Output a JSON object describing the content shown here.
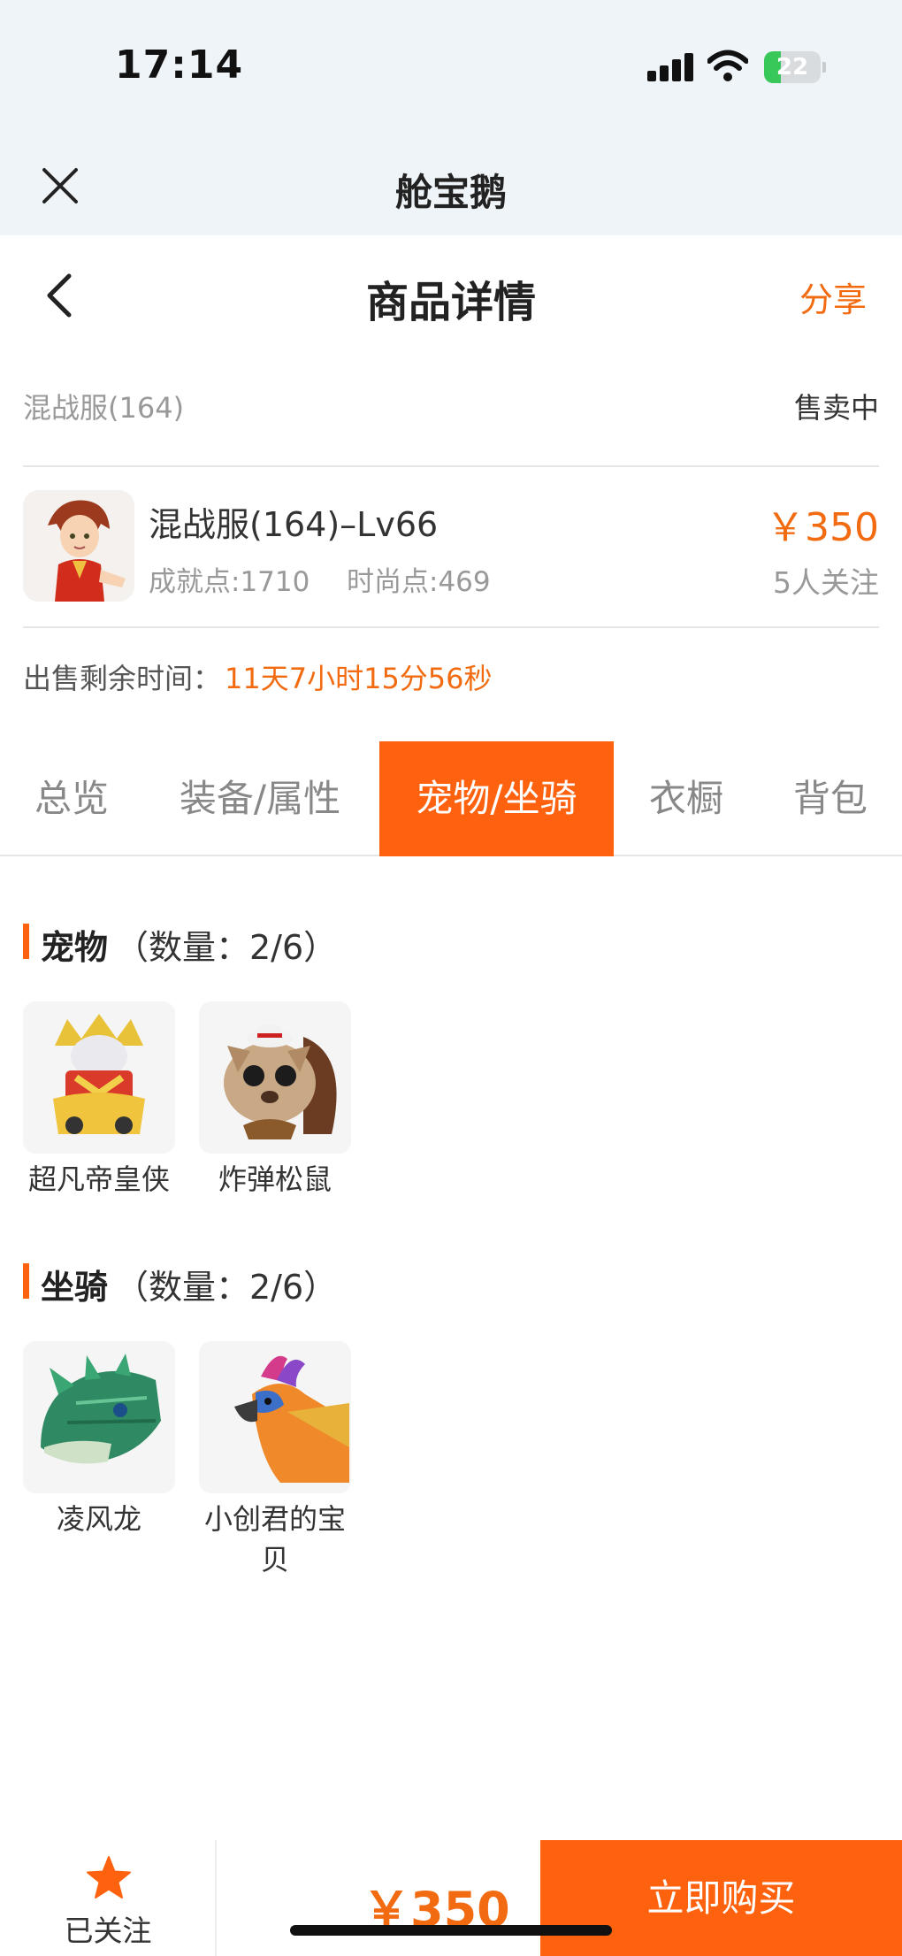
{
  "status_bar": {
    "time": "17:14",
    "battery": "22",
    "battery_level": 0.22
  },
  "mini_program": {
    "title": "舱宝鹅"
  },
  "header": {
    "title": "商品详情",
    "share": "分享"
  },
  "server": {
    "name": "混战服(164)",
    "status": "售卖中"
  },
  "product": {
    "title": "混战服(164)–Lv66",
    "achievement": "成就点:1710",
    "fashion": "时尚点:469",
    "price": "￥350",
    "followers": "5人关注"
  },
  "remaining": {
    "label": "出售剩余时间：",
    "value": "11天7小时15分56秒"
  },
  "tabs": [
    {
      "label": "总览",
      "active": false
    },
    {
      "label": "装备/属性",
      "active": false
    },
    {
      "label": "宠物/坐骑",
      "active": true
    },
    {
      "label": "衣橱",
      "active": false
    },
    {
      "label": "背包",
      "active": false
    }
  ],
  "pets": {
    "title": "宠物",
    "count": "（数量：2/6）",
    "items": [
      {
        "name": "超凡帝皇侠",
        "icon": "armored-hero-pet-image"
      },
      {
        "name": "炸弹松鼠",
        "icon": "bomb-squirrel-pet-image"
      }
    ]
  },
  "mounts": {
    "title": "坐骑",
    "count": "（数量：2/6）",
    "items": [
      {
        "name": "凌风龙",
        "icon": "green-dragon-mount-image"
      },
      {
        "name": "小创君的宝贝",
        "icon": "phoenix-bird-mount-image"
      }
    ]
  },
  "bottom": {
    "follow": "已关注",
    "price": "￥350",
    "buy": "立即购买"
  },
  "colors": {
    "accent": "#ff620e",
    "price": "#f26b11",
    "top_bg": "#eef4f7",
    "battery_green": "#38c759"
  }
}
